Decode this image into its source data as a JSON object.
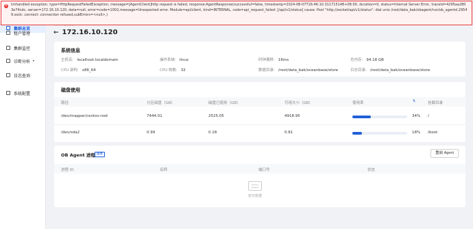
{
  "error": {
    "message": "Unhandled exception. type=HttpRequestFailedException, message=[AgentClient]http request is failed, response:AgentResponse(successful=false, timestamp=2024-08-07T16:46:10.311715148+08:00, duration=0, status=Internal Server Error, traceId=4295aa2803e74cdc, server=172.16.10.120, data=null, error=code=1002,message=Unexpected error. Module=api/client, kind=INTERNAL, code=api_request_failed: [/api/v1/status] cause: Post \"http://socket/api/v1/status\": dial unix /root/data_bak/obagent/run/ob_agentd.29549.sock: connect: connection refused,subErrors=<null>,)",
    "icon": "error-circle-icon"
  },
  "sidebar": {
    "items": [
      {
        "label": "集群总览",
        "icon": "dashboard-icon",
        "active": true
      },
      {
        "label": "租户管理",
        "icon": "tenant-icon"
      },
      {
        "label": "集群监控",
        "icon": "monitor-icon"
      },
      {
        "label": "诊断分析",
        "icon": "diagnosis-icon",
        "chevron": "▸"
      },
      {
        "label": "日志查询",
        "icon": "log-icon"
      },
      {
        "label": "系统配置",
        "icon": "settings-icon"
      }
    ]
  },
  "header": {
    "subtitle": "集群总览 / 172.16.10.120",
    "back": "←",
    "title": "172.16.10.120"
  },
  "system_info": {
    "title": "系统信息",
    "fields": [
      {
        "key": "主机名:",
        "value": "localhost.localdomain"
      },
      {
        "key": "操作系统:",
        "value": "linux"
      },
      {
        "key": "时钟偏移:",
        "value": "16ms"
      },
      {
        "key": "总内存:",
        "value": "94.18 GB"
      },
      {
        "key": "CPU 架构:",
        "value": "x86_64"
      },
      {
        "key": "CPU 核数:",
        "value": "32"
      },
      {
        "key": "数据目录:",
        "value": "/root/data_bak/oceanbase/store"
      },
      {
        "key": "日志目录:",
        "value": "/root/data_bak/oceanbase/store"
      }
    ]
  },
  "disk": {
    "title": "磁盘使用",
    "columns": [
      "路径",
      "分区磁盘（GB）",
      "磁盘已使用（GB）",
      "可用大小（GB）",
      "使用率",
      "挂载目录"
    ],
    "sort_icon": "⇅",
    "rows": [
      {
        "path": "/dev/mapper/centos-root",
        "total": "7444.01",
        "used": "2525.05",
        "avail": "4918.95",
        "usage": 34,
        "usage_text": "34%",
        "mount": "/"
      },
      {
        "path": "/dev/sda2",
        "total": "0.99",
        "used": "0.18",
        "avail": "0.81",
        "usage": 18,
        "usage_text": "18%",
        "mount": "/boot"
      }
    ]
  },
  "agent": {
    "title": "OB Agent 进程",
    "badge": "版本",
    "restart_label": "重启 Agent",
    "columns": [
      "进程 ID",
      "名称",
      "端口号",
      "状态"
    ],
    "empty_text": "暂无数据"
  },
  "colors": {
    "accent": "#1f5fd8",
    "error": "#e63939"
  }
}
